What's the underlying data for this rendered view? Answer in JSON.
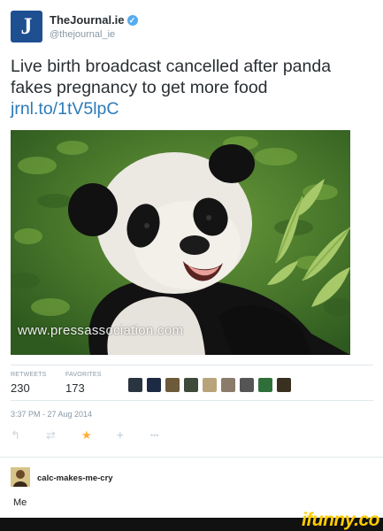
{
  "account": {
    "avatar_letter": "J",
    "name": "TheJournal.ie",
    "handle": "@thejournal_ie",
    "verified_glyph": "✓",
    "brand_color": "#1d4f91"
  },
  "tweet": {
    "text": "Live birth broadcast cancelled after panda fakes pregnancy to get more food",
    "link": "jrnl.to/1tV5lpC",
    "photo_watermark": "www.pressassociation.com",
    "photo_subject": "panda eating bamboo"
  },
  "stats": {
    "retweets_label": "RETWEETS",
    "retweets_value": "230",
    "favorites_label": "FAVORITES",
    "favorites_value": "173"
  },
  "timestamp": "3:37 PM - 27 Aug 2014",
  "actions": {
    "reply_icon": "↰",
    "retweet_icon": "⇄",
    "favorite_icon": "★",
    "follow_icon": "+",
    "more_icon": "•••",
    "favorite_color": "#ffac33"
  },
  "comment": {
    "username": "calc-makes-me-cry",
    "text": "Me"
  },
  "watermark": {
    "text": "ifunny.co",
    "color": "#ffcc00"
  }
}
